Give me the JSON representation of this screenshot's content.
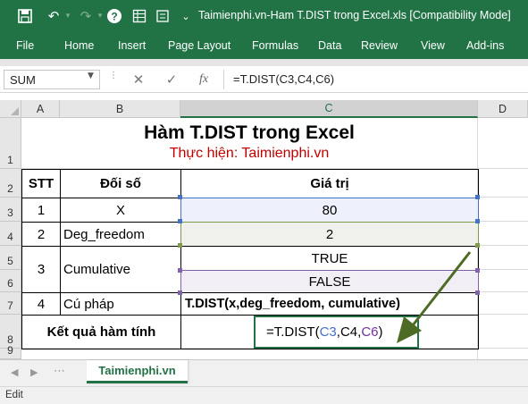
{
  "titlebar": {
    "title": "Taimienphi.vn-Ham T.DIST trong Excel.xls  [Compatibility Mode]",
    "icons": [
      "save-icon",
      "undo-icon",
      "redo-icon",
      "help-icon",
      "sheet-icon",
      "spacer-icon",
      "dropdown-icon"
    ]
  },
  "ribbon": {
    "tabs": [
      "File",
      "Home",
      "Insert",
      "Page Layout",
      "Formulas",
      "Data",
      "Review",
      "View",
      "Add-ins"
    ]
  },
  "formula_bar": {
    "name_box": "SUM",
    "formula": "=T.DIST(C3,C4,C6)"
  },
  "columns": [
    "A",
    "B",
    "C",
    "D"
  ],
  "rows": [
    "1",
    "2",
    "3",
    "4",
    "5",
    "6",
    "7",
    "8",
    "9"
  ],
  "sheet": {
    "title": "Hàm T.DIST trong Excel",
    "subtitle": "Thực hiện: Taimienphi.vn",
    "headers": {
      "stt": "STT",
      "arg": "Đối số",
      "value": "Giá trị"
    },
    "r3": {
      "stt": "1",
      "arg": "X",
      "value": "80"
    },
    "r4": {
      "stt": "2",
      "arg": "Deg_freedom",
      "value": "2"
    },
    "r5": {
      "stt": "3",
      "arg": "Cumulative",
      "value_true": "TRUE",
      "value_false": "FALSE"
    },
    "r7": {
      "stt": "4",
      "arg": "Cú pháp",
      "value": "T.DIST(x,deg_freedom, cumulative)"
    },
    "r8": {
      "label": "Kết quả hàm tính",
      "formula_parts": [
        "=T.DIST(",
        "C3",
        ",",
        "C4",
        ",",
        "C6",
        ")"
      ]
    }
  },
  "sheet_tabs": {
    "active": "Taimienphi.vn"
  },
  "status": {
    "mode": "Edit"
  },
  "colors": {
    "excel_green": "#217346",
    "subtitle_red": "#c00000",
    "ref_blue": "#4472c4",
    "ref_green": "#548235",
    "ref_purple": "#7030a0",
    "arrow_olive": "#4e6b26"
  }
}
